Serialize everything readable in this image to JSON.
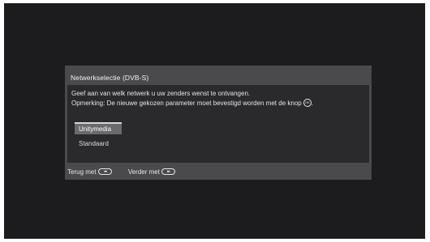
{
  "dialog": {
    "title": "Netwerkselectie (DVB-S)",
    "instruction_line1": "Geef aan van welk netwerk u uw zenders wenst te ontvangen.",
    "instruction_line2": "Opmerking: De nieuwe gekozen parameter moet bevestigd worden met de knop",
    "instruction_line2_end": ".",
    "ok_icon_label": "OK",
    "options": [
      {
        "label": "Unitymedia",
        "selected": true
      },
      {
        "label": "Standaard",
        "selected": false
      }
    ]
  },
  "footer": {
    "back_label": "Terug met",
    "back_icon": "rewind-icon",
    "back_glyph": "◂◂",
    "next_label": "Verder met",
    "next_icon": "fast-forward-icon",
    "next_glyph": "▸▸"
  },
  "colors": {
    "screen_bg": "#1c1b1d",
    "dialog_bg": "#4a4a4c",
    "body_bg": "#2a292b",
    "selection_bg": "#6a6a6c"
  }
}
